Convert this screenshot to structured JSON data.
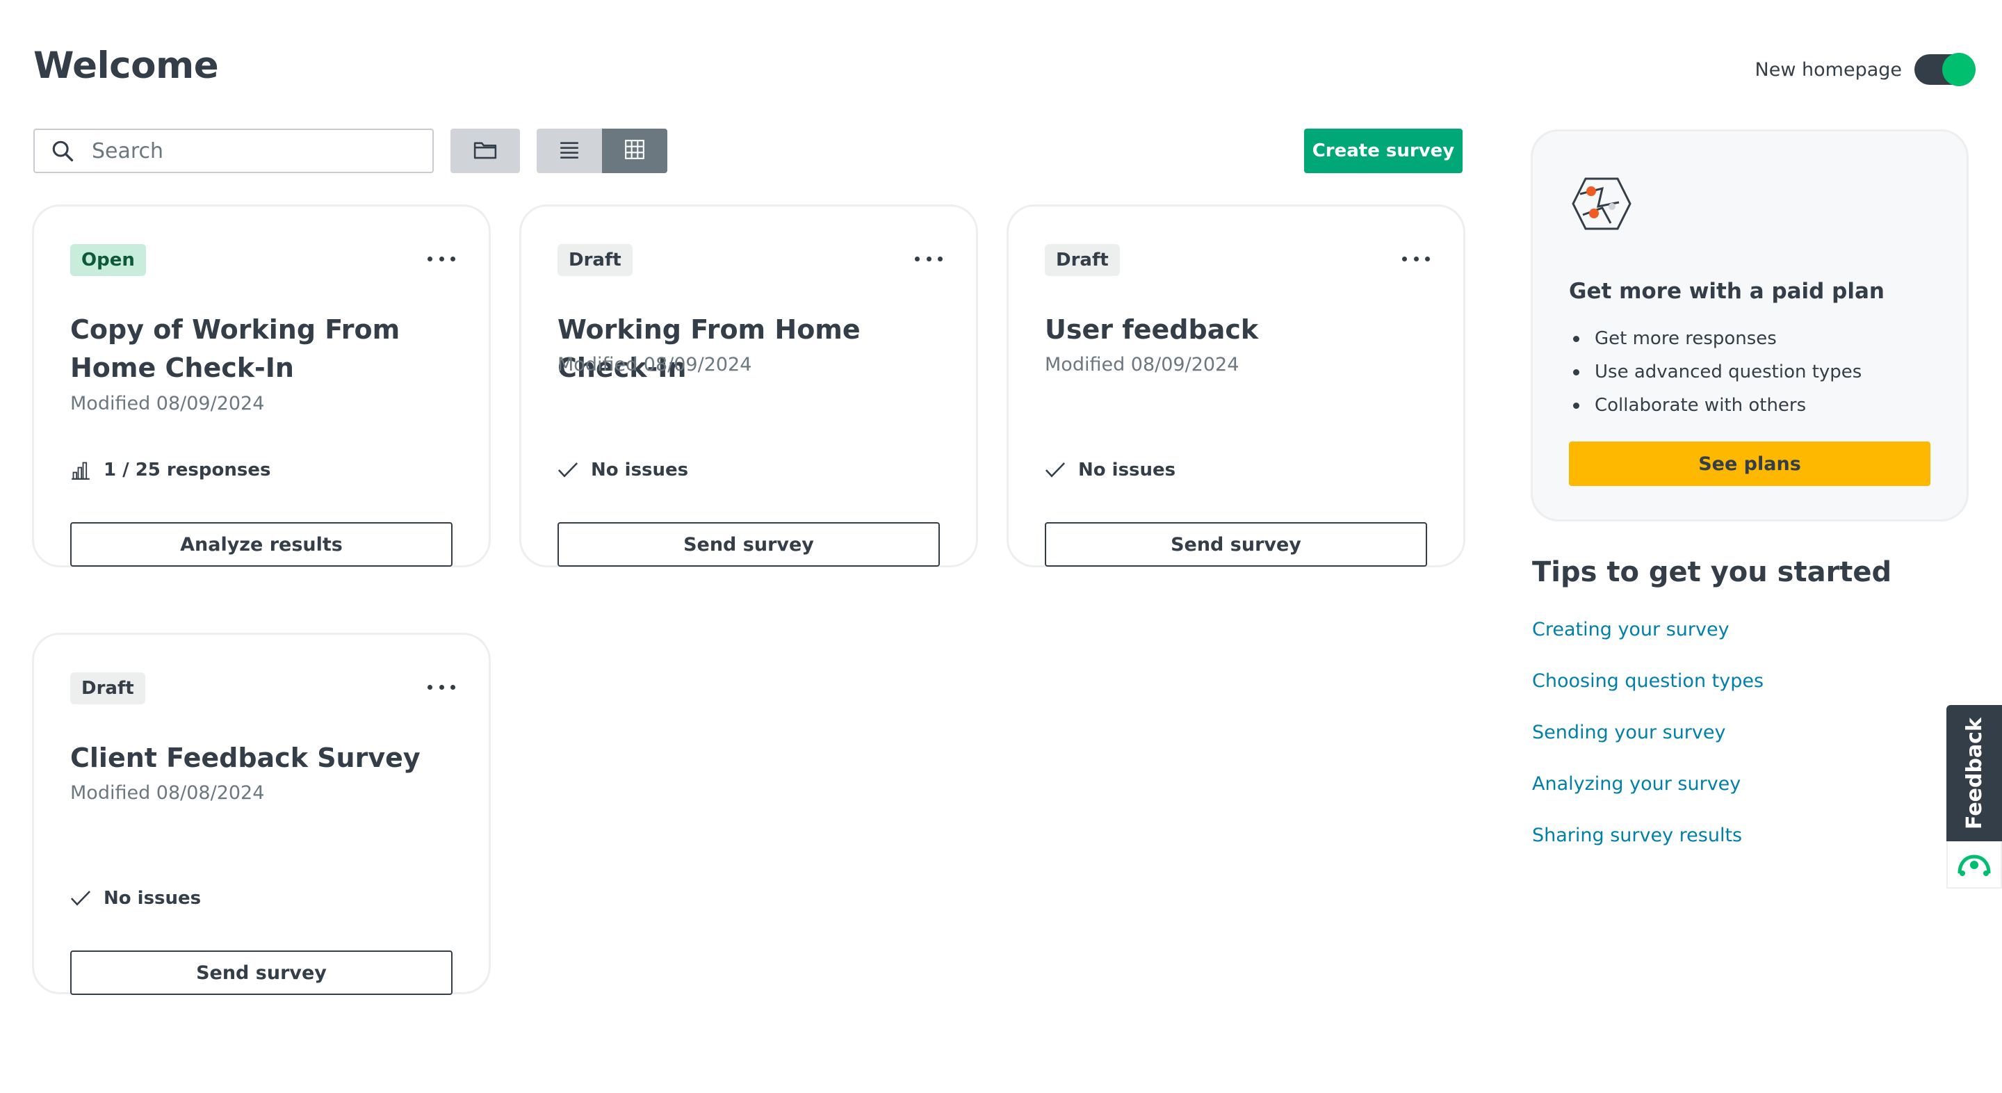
{
  "header": {
    "title": "Welcome",
    "toggle_label": "New homepage"
  },
  "toolbar": {
    "search_placeholder": "Search",
    "create_label": "Create survey"
  },
  "surveys": [
    {
      "status": "Open",
      "title": "Copy of Working From Home Check-In",
      "modified": "Modified 08/09/2024",
      "info": "1 / 25 responses",
      "action": "Analyze results"
    },
    {
      "status": "Draft",
      "title": "Working From Home Check-In",
      "modified": "Modified 08/09/2024",
      "info": "No issues",
      "action": "Send survey"
    },
    {
      "status": "Draft",
      "title": "User feedback",
      "modified": "Modified 08/09/2024",
      "info": "No issues",
      "action": "Send survey"
    },
    {
      "status": "Draft",
      "title": "Client Feedback Survey",
      "modified": "Modified 08/08/2024",
      "info": "No issues",
      "action": "Send survey"
    }
  ],
  "promo": {
    "title": "Get more with a paid plan",
    "items": [
      "Get more responses",
      "Use advanced question types",
      "Collaborate with others"
    ],
    "button": "See plans"
  },
  "tips": {
    "title": "Tips to get you started",
    "links": [
      "Creating your survey",
      "Choosing question types",
      "Sending your survey",
      "Analyzing your survey",
      "Sharing survey results"
    ]
  },
  "feedback_tab": {
    "label": "Feedback"
  },
  "colors": {
    "primary_green": "#00a878",
    "toggle_green": "#00bf6f",
    "cta_yellow": "#ffb800",
    "link_blue": "#007faa",
    "text_dark": "#333e48"
  }
}
